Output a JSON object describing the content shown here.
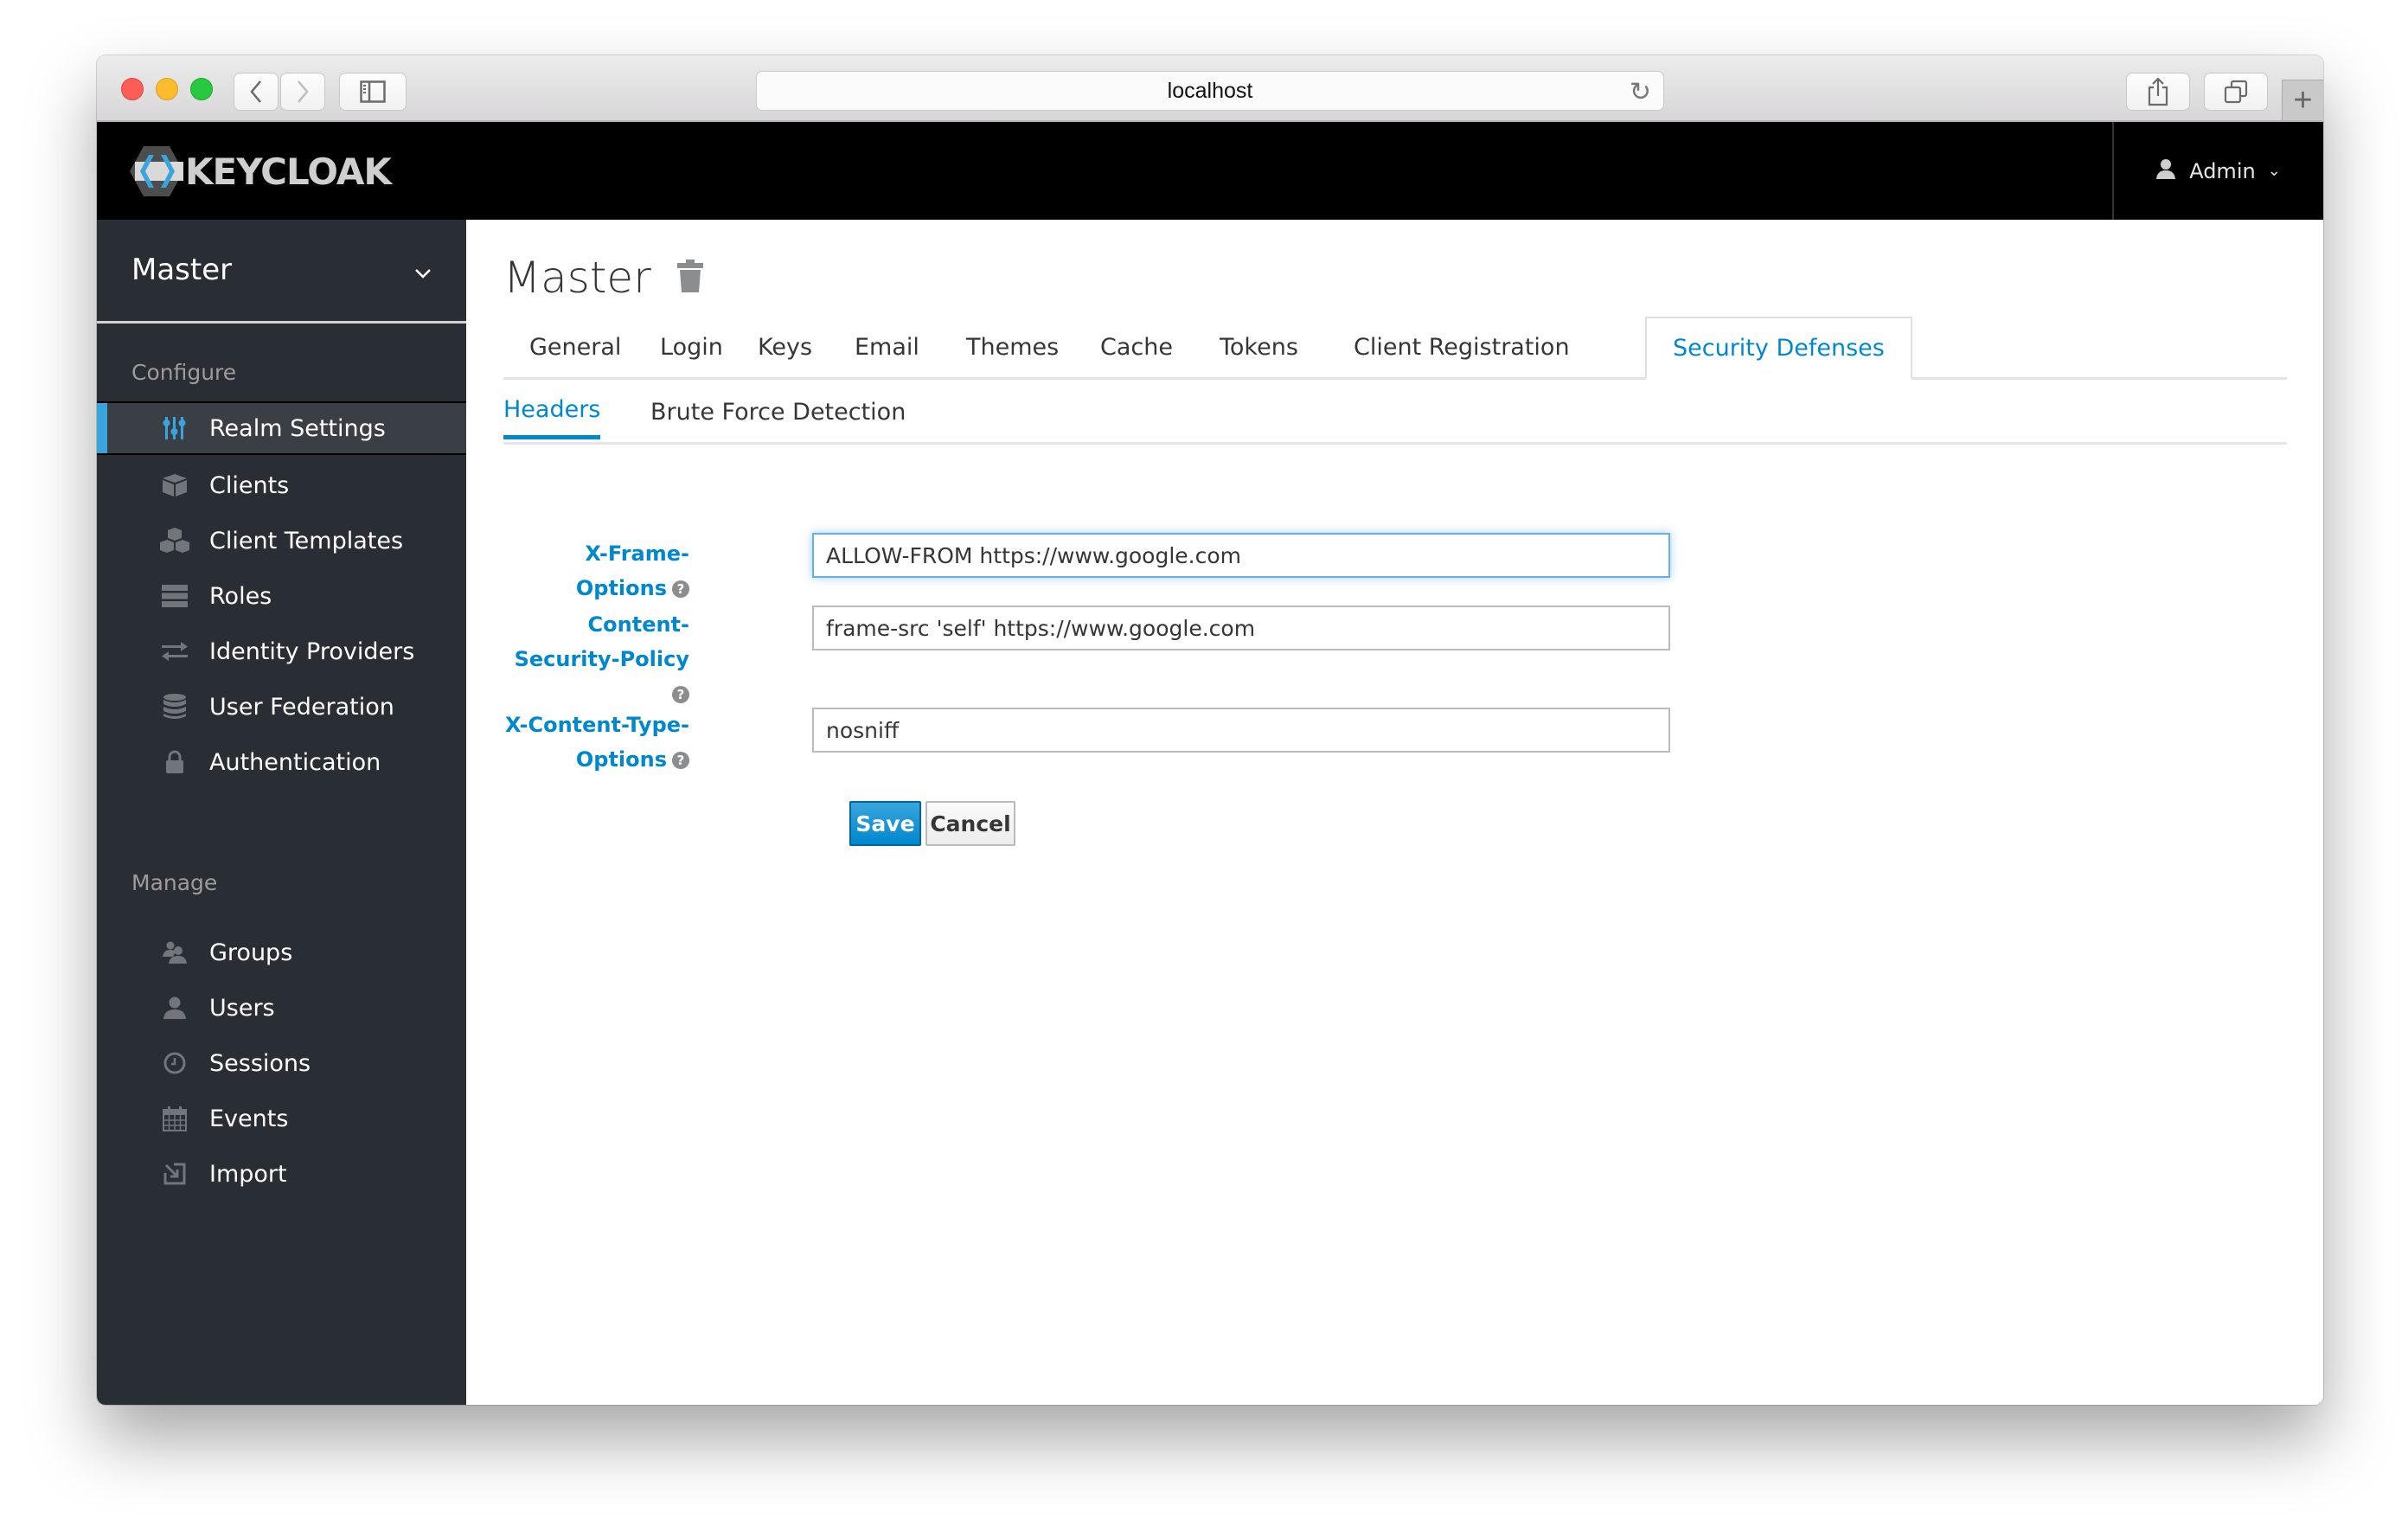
{
  "browser": {
    "url": "localhost",
    "traffic_lights": {
      "close": "#fc5d57",
      "minimize": "#fdbc2e",
      "maximize": "#28c840"
    },
    "icons": {
      "back": "chevron-left-icon",
      "forward": "chevron-right-icon",
      "sidebar": "sidebar-icon",
      "reload": "reload-icon",
      "share": "share-icon",
      "tabs": "tabs-overview-icon",
      "new_tab": "plus-icon"
    }
  },
  "header": {
    "brand": "KEYCLOAK",
    "user": {
      "name": "Admin",
      "icon": "user-icon",
      "caret": "chevron-down-icon"
    }
  },
  "sidebar": {
    "realm": "Master",
    "sections": [
      {
        "label": "Configure",
        "items": [
          {
            "label": "Realm Settings",
            "icon": "sliders-icon",
            "active": true
          },
          {
            "label": "Clients",
            "icon": "cube-icon",
            "active": false
          },
          {
            "label": "Client Templates",
            "icon": "cubes-icon",
            "active": false
          },
          {
            "label": "Roles",
            "icon": "server-icon",
            "active": false
          },
          {
            "label": "Identity Providers",
            "icon": "exchange-icon",
            "active": false
          },
          {
            "label": "User Federation",
            "icon": "database-icon",
            "active": false
          },
          {
            "label": "Authentication",
            "icon": "lock-icon",
            "active": false
          }
        ]
      },
      {
        "label": "Manage",
        "items": [
          {
            "label": "Groups",
            "icon": "users-icon",
            "active": false
          },
          {
            "label": "Users",
            "icon": "user-icon",
            "active": false
          },
          {
            "label": "Sessions",
            "icon": "clock-icon",
            "active": false
          },
          {
            "label": "Events",
            "icon": "calendar-icon",
            "active": false
          },
          {
            "label": "Import",
            "icon": "import-icon",
            "active": false
          }
        ]
      }
    ]
  },
  "main": {
    "title": "Master",
    "delete_icon": "trash-icon",
    "tabs": [
      {
        "label": "General",
        "active": false
      },
      {
        "label": "Login",
        "active": false
      },
      {
        "label": "Keys",
        "active": false
      },
      {
        "label": "Email",
        "active": false
      },
      {
        "label": "Themes",
        "active": false
      },
      {
        "label": "Cache",
        "active": false
      },
      {
        "label": "Tokens",
        "active": false
      },
      {
        "label": "Client Registration",
        "active": false
      },
      {
        "label": "Security Defenses",
        "active": true
      }
    ],
    "subtabs": [
      {
        "label": "Headers",
        "active": true
      },
      {
        "label": "Brute Force Detection",
        "active": false
      }
    ],
    "form": {
      "fields": [
        {
          "label": "X-Frame-Options",
          "value": "ALLOW-FROM https://www.google.com",
          "focused": true
        },
        {
          "label": "Content-Security-Policy",
          "value": "frame-src 'self' https://www.google.com",
          "focused": false
        },
        {
          "label_line1": "X-Content-Type-",
          "label_line2": "Options",
          "value": "nosniff",
          "focused": false
        }
      ],
      "help_glyph": "?",
      "save_label": "Save",
      "cancel_label": "Cancel"
    },
    "accent_color": "#0088ce"
  }
}
